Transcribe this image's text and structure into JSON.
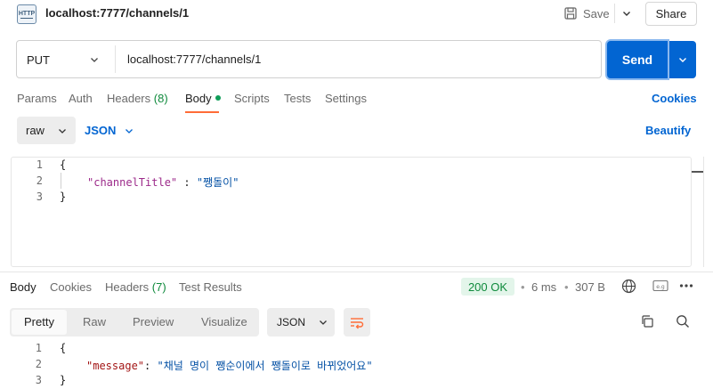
{
  "header": {
    "request_title": "localhost:7777/channels/1",
    "icon_text": "HTTP",
    "save_label": "Save",
    "share_label": "Share"
  },
  "request": {
    "method": "PUT",
    "url": "localhost:7777/channels/1",
    "send_label": "Send"
  },
  "request_tabs": {
    "params": "Params",
    "auth": "Auth",
    "headers": "Headers",
    "headers_count": "(8)",
    "body": "Body",
    "scripts": "Scripts",
    "tests": "Tests",
    "settings": "Settings",
    "cookies": "Cookies"
  },
  "body_options": {
    "mode": "raw",
    "language": "JSON",
    "beautify": "Beautify"
  },
  "request_body": {
    "line_numbers": [
      "1",
      "2",
      "3"
    ],
    "open_brace": "{",
    "key": "\"channelTitle\"",
    "colon": " : ",
    "value": "\"쨍돌이\"",
    "close_brace": "}"
  },
  "response_tabs": {
    "body": "Body",
    "cookies": "Cookies",
    "headers": "Headers",
    "headers_count": "(7)",
    "test_results": "Test Results"
  },
  "response_meta": {
    "status": "200 OK",
    "time": "6 ms",
    "size": "307 B",
    "separator": "•"
  },
  "response_view": {
    "pretty": "Pretty",
    "raw": "Raw",
    "preview": "Preview",
    "visualize": "Visualize",
    "format": "JSON"
  },
  "response_body": {
    "line_numbers": [
      "1",
      "2",
      "3"
    ],
    "open_brace": "{",
    "key": "\"message\"",
    "colon": ": ",
    "value": "\"채널 명이 쨍순이에서 쨍돌이로 바뀌었어요\"",
    "close_brace": "}"
  },
  "colors": {
    "accent": "#0265d2",
    "active_tab_underline": "#ff6c37",
    "status_ok": "#0f8a3c"
  }
}
